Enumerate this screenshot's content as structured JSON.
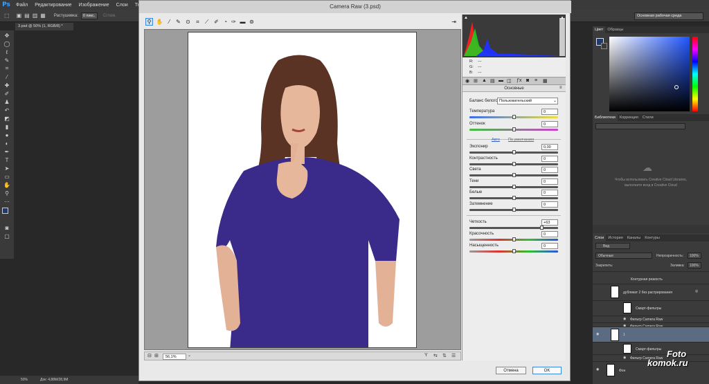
{
  "app": {
    "logo": "Ps"
  },
  "menu": [
    "Файл",
    "Редактирование",
    "Изображение",
    "Слои",
    "Текст"
  ],
  "options": {
    "feather_label": "Растушевка:",
    "feather_value": "0 пикс.",
    "smooth_label": "Сглаж."
  },
  "workspace": "Основная рабочая среда",
  "doc_tab": "3.psd @ 50% (1, RGB/8) *",
  "status": {
    "zoom": "50%",
    "doc": "Док: 4,88M/28,9M"
  },
  "dialog": {
    "title": "Camera Raw (3.psd)",
    "zoom": "56,1%",
    "rgb": {
      "r_label": "R:",
      "g_label": "G:",
      "b_label": "B:",
      "r": "---",
      "g": "---",
      "b": "---"
    },
    "section": "Основные",
    "wb_label": "Баланс белого:",
    "wb_value": "Пользовательский",
    "auto": "Авто",
    "default": "По умолчанию",
    "sliders": [
      {
        "label": "Температура",
        "value": "0",
        "pos": 0.5
      },
      {
        "label": "Оттенок",
        "value": "0",
        "pos": 0.5
      },
      {
        "label": "Экспонир",
        "value": "0,00",
        "pos": 0.5
      },
      {
        "label": "Контрастность",
        "value": "0",
        "pos": 0.5
      },
      {
        "label": "Света",
        "value": "0",
        "pos": 0.5
      },
      {
        "label": "Тени",
        "value": "0",
        "pos": 0.5
      },
      {
        "label": "Белые",
        "value": "0",
        "pos": 0.5
      },
      {
        "label": "Затемнение",
        "value": "0",
        "pos": 0.5
      },
      {
        "label": "Четкость",
        "value": "+63",
        "pos": 0.815
      },
      {
        "label": "Красочность",
        "value": "0",
        "pos": 0.5
      },
      {
        "label": "Насыщенность",
        "value": "0",
        "pos": 0.5
      }
    ],
    "cancel": "Отмена",
    "ok": "OK"
  },
  "panels": {
    "color_tabs": [
      "Цвет",
      "Образцы"
    ],
    "lib_tabs": [
      "Библиотеки",
      "Коррекция",
      "Стили"
    ],
    "lib_msg": "Чтобы использовать Creative Cloud Libraries, выполните вход в Creative Cloud",
    "layer_tabs": [
      "Слои",
      "История",
      "Каналы",
      "Контуры"
    ],
    "kind": "Вид",
    "blend": "Обычные",
    "opacity_label": "Непрозрачность:",
    "opacity": "100%",
    "lock_label": "Закрепить:",
    "fill_label": "Заливка:",
    "fill": "100%",
    "layers": [
      {
        "name": "Контурная резкость"
      },
      {
        "name": "дубликат 2 без растрирования"
      },
      {
        "name": "Смарт-фильтры"
      },
      {
        "name": "Фильтр Camera Raw"
      },
      {
        "name": "Фильтр Camera Raw"
      },
      {
        "name": "1"
      },
      {
        "name": "Смарт-фильтры"
      },
      {
        "name": "Фильтр Camera Raw"
      },
      {
        "name": "Фон"
      }
    ]
  },
  "watermark": {
    "line1": "Foto",
    "line2": "komok.ru"
  },
  "colors": {
    "accent": "#3a86d8",
    "shirt": "#3a2a8a",
    "hair": "#5a3324"
  }
}
